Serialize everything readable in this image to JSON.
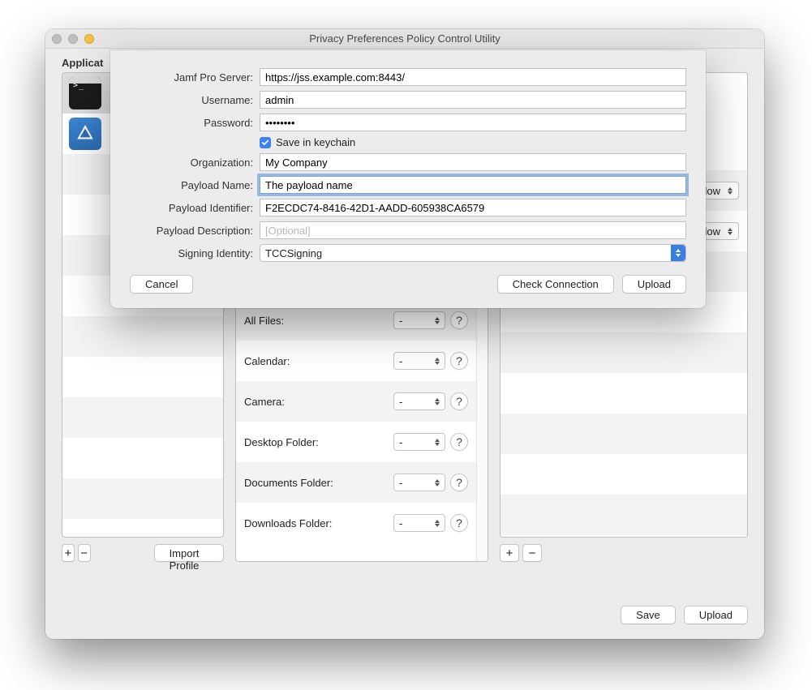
{
  "window": {
    "title": "Privacy Preferences Policy Control Utility",
    "applications_label": "Applicat",
    "import_profile": "Import Profile",
    "save_label": "Save",
    "upload_label": "Upload",
    "plus": "+",
    "minus": "−"
  },
  "apps": [
    {
      "name": "Terminal",
      "icon": "terminal"
    },
    {
      "name": "Xcode",
      "icon": "xcode"
    }
  ],
  "properties": [
    {
      "label": "All Files:",
      "value": "-"
    },
    {
      "label": "Calendar:",
      "value": "-"
    },
    {
      "label": "Camera:",
      "value": "-"
    },
    {
      "label": "Desktop Folder:",
      "value": "-"
    },
    {
      "label": "Documents Folder:",
      "value": "-"
    },
    {
      "label": "Downloads Folder:",
      "value": "-"
    }
  ],
  "right": {
    "select1": "Allow",
    "select2": "Allow"
  },
  "sheet": {
    "server_label": "Jamf Pro Server:",
    "server_value": "https://jss.example.com:8443/",
    "username_label": "Username:",
    "username_value": "admin",
    "password_label": "Password:",
    "password_value": "••••••••",
    "save_keychain": "Save in keychain",
    "org_label": "Organization:",
    "org_value": "My Company",
    "payload_name_label": "Payload Name:",
    "payload_name_value": "The payload name",
    "payload_id_label": "Payload Identifier:",
    "payload_id_value": "F2ECDC74-8416-42D1-AADD-605938CA6579",
    "payload_desc_label": "Payload Description:",
    "payload_desc_placeholder": "[Optional]",
    "signing_label": "Signing Identity:",
    "signing_value": "TCCSigning",
    "cancel": "Cancel",
    "check_connection": "Check Connection",
    "upload": "Upload"
  }
}
